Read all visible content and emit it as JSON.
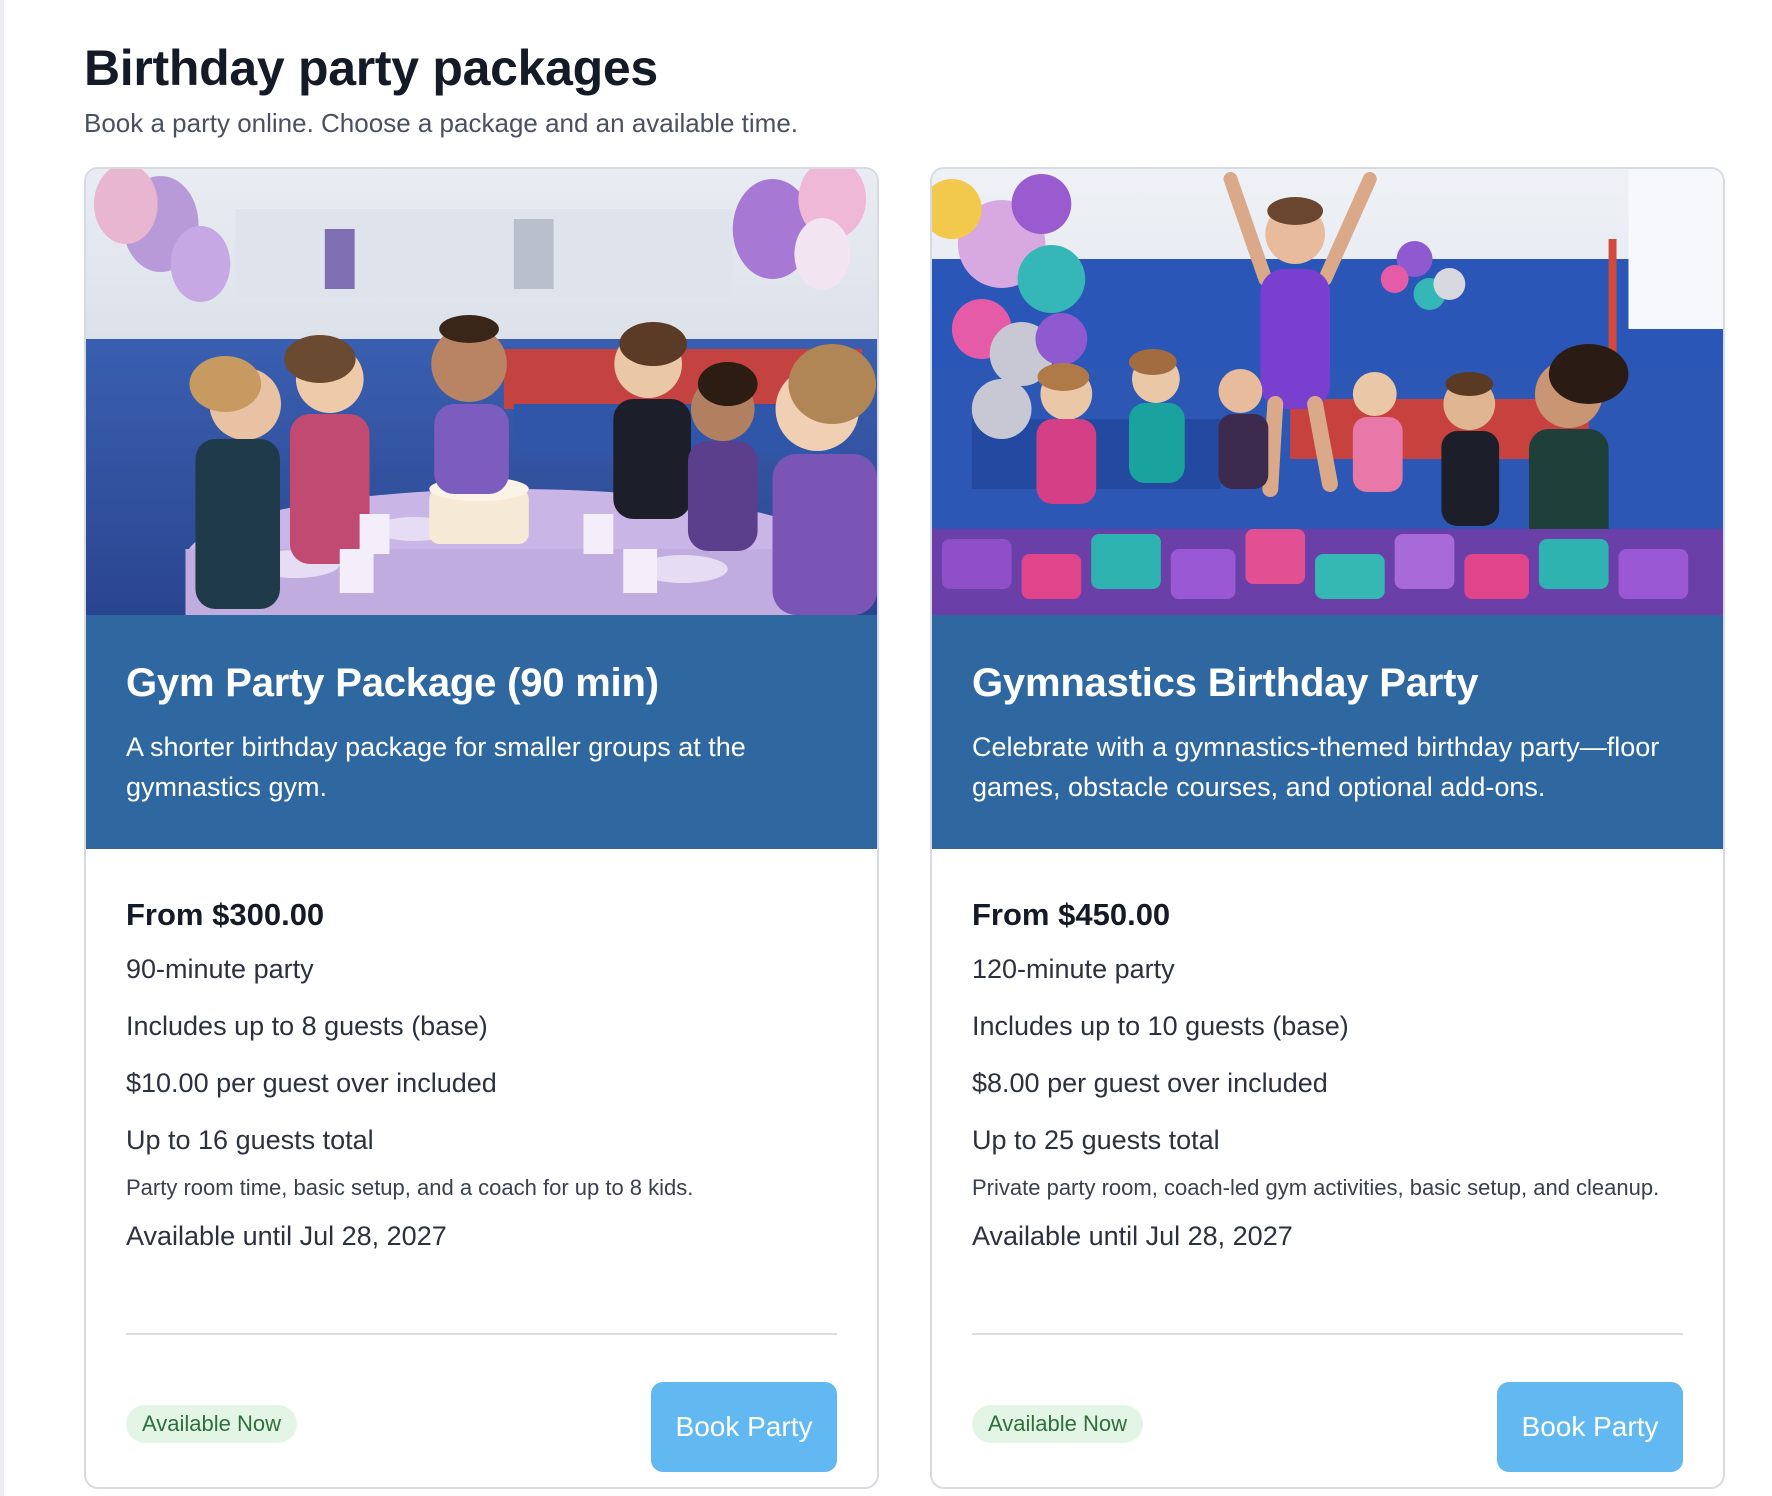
{
  "page": {
    "title": "Birthday party packages",
    "subtitle": "Book a party online. Choose a package and an available time."
  },
  "packages": [
    {
      "image_alt": "Kids celebrating with a birthday cake at a gymnastics gym",
      "title": "Gym Party Package (90 min)",
      "description": "A shorter birthday package for smaller groups at the gymnastics gym.",
      "price": "From $300.00",
      "duration": "90-minute party",
      "included_guests": "Includes up to 8 guests (base)",
      "extra_guest_fee": "$10.00 per guest over included",
      "max_guests": "Up to 16 guests total",
      "note": "Party room time, basic setup, and a coach for up to 8 kids.",
      "available_until": "Available until Jul 28, 2027",
      "status": "Available Now",
      "button_label": "Book Party"
    },
    {
      "image_alt": "Gymnast jumping into a foam pit while kids cheer",
      "title": "Gymnastics Birthday Party",
      "description": "Celebrate with a gymnastics-themed birthday party—floor games, obstacle courses, and optional add-ons.",
      "price": "From $450.00",
      "duration": "120-minute party",
      "included_guests": "Includes up to 10 guests (base)",
      "extra_guest_fee": "$8.00 per guest over included",
      "max_guests": "Up to 25 guests total",
      "note": "Private party room, coach-led gym activities, basic setup, and cleanup.",
      "available_until": "Available until Jul 28, 2027",
      "status": "Available Now",
      "button_label": "Book Party"
    }
  ],
  "colors": {
    "banner": "#2f68a0",
    "button": "#62b8f0",
    "badge_bg": "#e3f6e6",
    "badge_text": "#2f6f3a",
    "card_border": "#d7dae0"
  }
}
